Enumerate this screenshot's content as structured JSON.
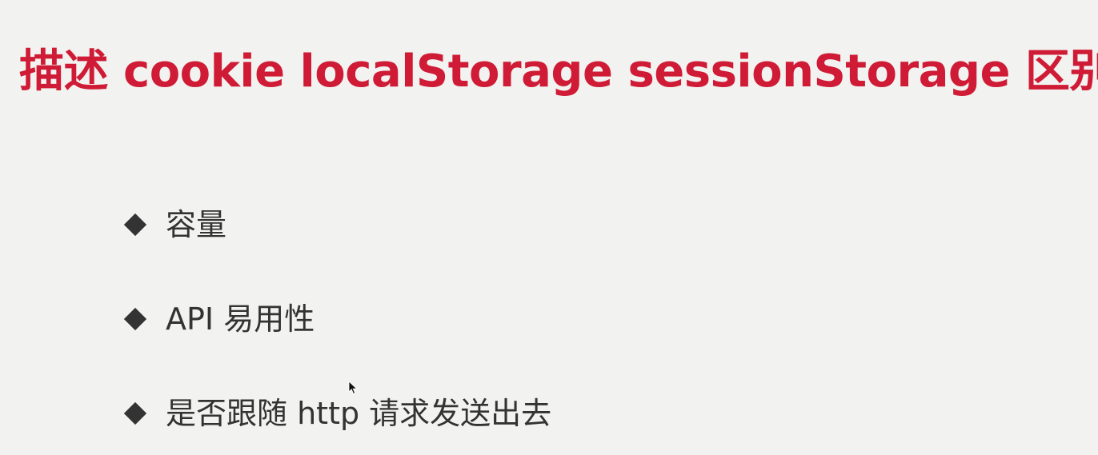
{
  "slide": {
    "title": "描述 cookie localStorage sessionStorage 区别",
    "title_color": "#cf1b35",
    "background_color": "#f2f3f1",
    "bullets": [
      {
        "icon": "diamond-bullet",
        "label": "容量"
      },
      {
        "icon": "diamond-bullet",
        "label": "API 易用性"
      },
      {
        "icon": "diamond-bullet",
        "label": "是否跟随 http 请求发送出去"
      }
    ]
  }
}
